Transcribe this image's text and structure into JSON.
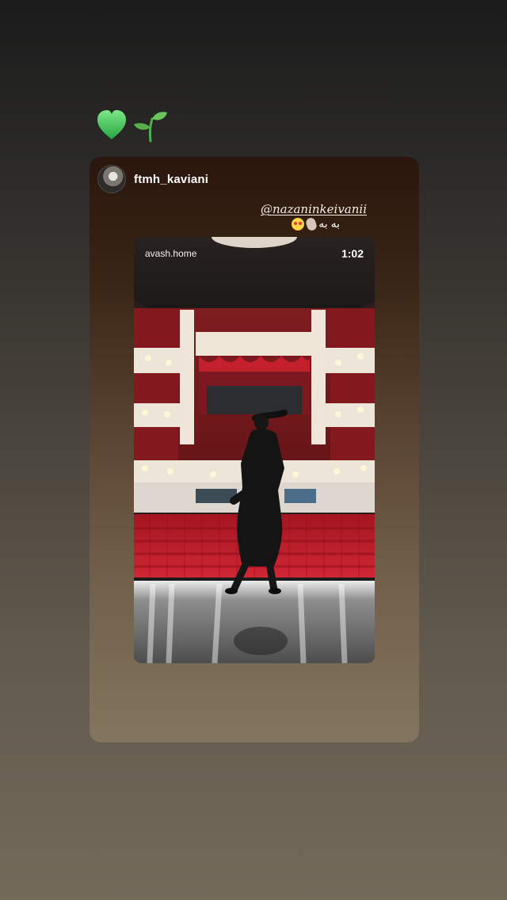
{
  "story": {
    "stickers": {
      "heart": "green-heart",
      "sprout": "seedling"
    },
    "card": {
      "username": "ftmh_kaviani",
      "mention": "@nazaninkeivanii",
      "caption": "به به",
      "video": {
        "label": "avash.home",
        "time": "1:02"
      }
    }
  },
  "colors": {
    "background_top": "#1b1b1b",
    "background_bottom": "#746a5a",
    "card_top": "#2a160c",
    "card_bottom": "#83755f",
    "accent_green": "#32c45a",
    "theater_red": "#c21f2d"
  }
}
